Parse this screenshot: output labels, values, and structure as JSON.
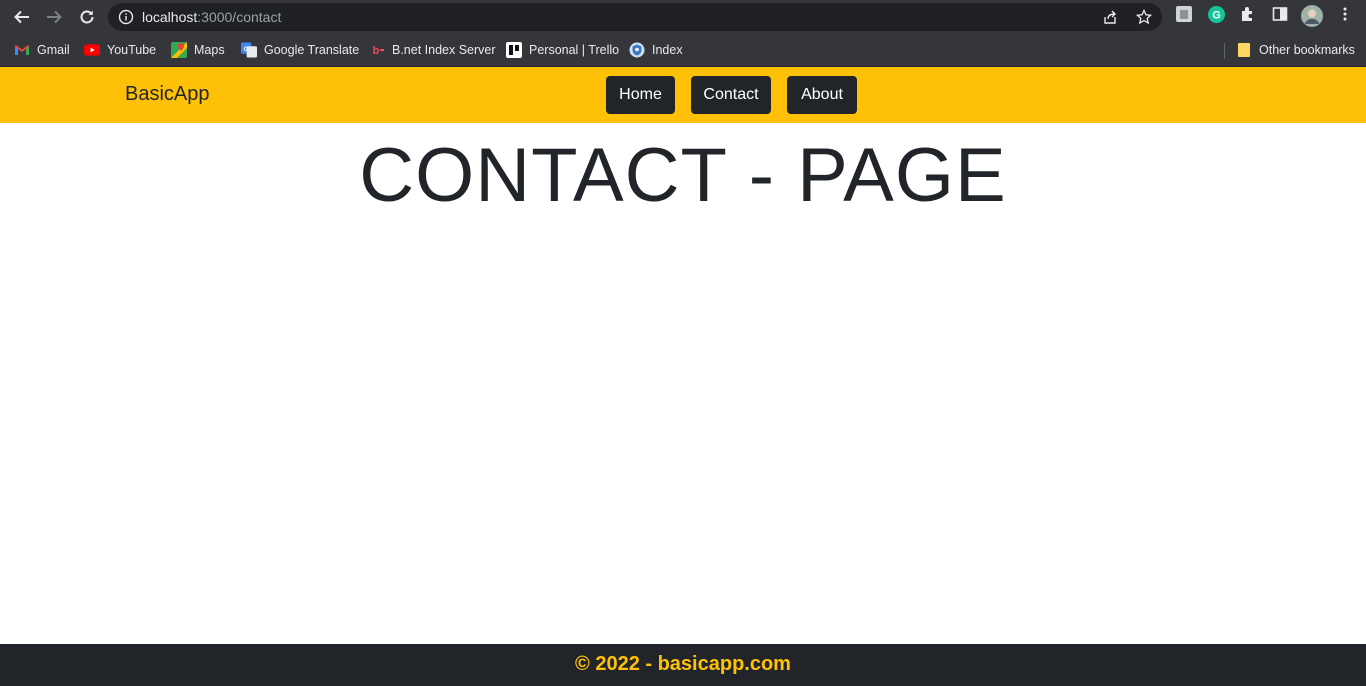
{
  "browser": {
    "url_host": "localhost",
    "url_path": ":3000/contact",
    "bookmarks": [
      {
        "label": "Gmail",
        "icon": "gmail-icon"
      },
      {
        "label": "YouTube",
        "icon": "youtube-icon"
      },
      {
        "label": "Maps",
        "icon": "maps-icon"
      },
      {
        "label": "Google Translate",
        "icon": "translate-icon"
      },
      {
        "label": "B.net Index Server",
        "icon": "bnet-icon"
      },
      {
        "label": "Personal | Trello",
        "icon": "trello-icon"
      },
      {
        "label": "Index",
        "icon": "index-icon"
      }
    ],
    "other_bookmarks": "Other bookmarks"
  },
  "navbar": {
    "brand": "BasicApp",
    "links": [
      "Home",
      "Contact",
      "About"
    ],
    "background": "#ffc107",
    "button_color": "#212529"
  },
  "main": {
    "title": "CONTACT - PAGE"
  },
  "footer": {
    "text": "© 2022 - basicapp.com",
    "text_color": "#ffc107"
  }
}
